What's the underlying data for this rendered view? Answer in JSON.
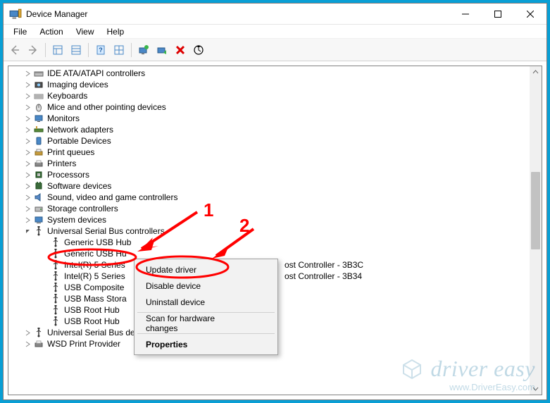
{
  "window": {
    "title": "Device Manager"
  },
  "menubar": [
    "File",
    "Action",
    "View",
    "Help"
  ],
  "tree": [
    {
      "level": 1,
      "expand": "closed",
      "icon": "ide",
      "label": "IDE ATA/ATAPI controllers"
    },
    {
      "level": 1,
      "expand": "closed",
      "icon": "imaging",
      "label": "Imaging devices"
    },
    {
      "level": 1,
      "expand": "closed",
      "icon": "keyboard",
      "label": "Keyboards"
    },
    {
      "level": 1,
      "expand": "closed",
      "icon": "mouse",
      "label": "Mice and other pointing devices"
    },
    {
      "level": 1,
      "expand": "closed",
      "icon": "monitor",
      "label": "Monitors"
    },
    {
      "level": 1,
      "expand": "closed",
      "icon": "net",
      "label": "Network adapters"
    },
    {
      "level": 1,
      "expand": "closed",
      "icon": "portable",
      "label": "Portable Devices"
    },
    {
      "level": 1,
      "expand": "closed",
      "icon": "printq",
      "label": "Print queues"
    },
    {
      "level": 1,
      "expand": "closed",
      "icon": "printer",
      "label": "Printers"
    },
    {
      "level": 1,
      "expand": "closed",
      "icon": "cpu",
      "label": "Processors"
    },
    {
      "level": 1,
      "expand": "closed",
      "icon": "soft",
      "label": "Software devices"
    },
    {
      "level": 1,
      "expand": "closed",
      "icon": "sound",
      "label": "Sound, video and game controllers"
    },
    {
      "level": 1,
      "expand": "closed",
      "icon": "storage",
      "label": "Storage controllers"
    },
    {
      "level": 1,
      "expand": "closed",
      "icon": "system",
      "label": "System devices"
    },
    {
      "level": 1,
      "expand": "open",
      "icon": "usb",
      "label": "Universal Serial Bus controllers"
    },
    {
      "level": 2,
      "expand": "none",
      "icon": "usb",
      "label": "Generic USB Hub",
      "selected": true
    },
    {
      "level": 2,
      "expand": "none",
      "icon": "usb",
      "label": "Generic USB Hu"
    },
    {
      "level": 2,
      "expand": "none",
      "icon": "usb",
      "label": "Intel(R) 5 Series",
      "tail": "ost Controller - 3B3C"
    },
    {
      "level": 2,
      "expand": "none",
      "icon": "usb",
      "label": "Intel(R) 5 Series",
      "tail": "ost Controller - 3B34"
    },
    {
      "level": 2,
      "expand": "none",
      "icon": "usb",
      "label": "USB Composite"
    },
    {
      "level": 2,
      "expand": "none",
      "icon": "usb",
      "label": "USB Mass Stora"
    },
    {
      "level": 2,
      "expand": "none",
      "icon": "usb",
      "label": "USB Root Hub"
    },
    {
      "level": 2,
      "expand": "none",
      "icon": "usb",
      "label": "USB Root Hub"
    },
    {
      "level": 1,
      "expand": "closed",
      "icon": "usb",
      "label": "Universal Serial Bus devices"
    },
    {
      "level": 1,
      "expand": "closed",
      "icon": "wsd",
      "label": "WSD Print Provider"
    }
  ],
  "context_menu": [
    {
      "type": "item",
      "label": "Update driver"
    },
    {
      "type": "item",
      "label": "Disable device"
    },
    {
      "type": "item",
      "label": "Uninstall device"
    },
    {
      "type": "sep"
    },
    {
      "type": "item",
      "label": "Scan for hardware changes"
    },
    {
      "type": "sep"
    },
    {
      "type": "item",
      "label": "Properties",
      "bold": true
    }
  ],
  "annotations": {
    "num1": "1",
    "num2": "2"
  },
  "watermark": {
    "brand": "driver easy",
    "url": "www.DriverEasy.com"
  },
  "context_menu_tail_x": 392
}
